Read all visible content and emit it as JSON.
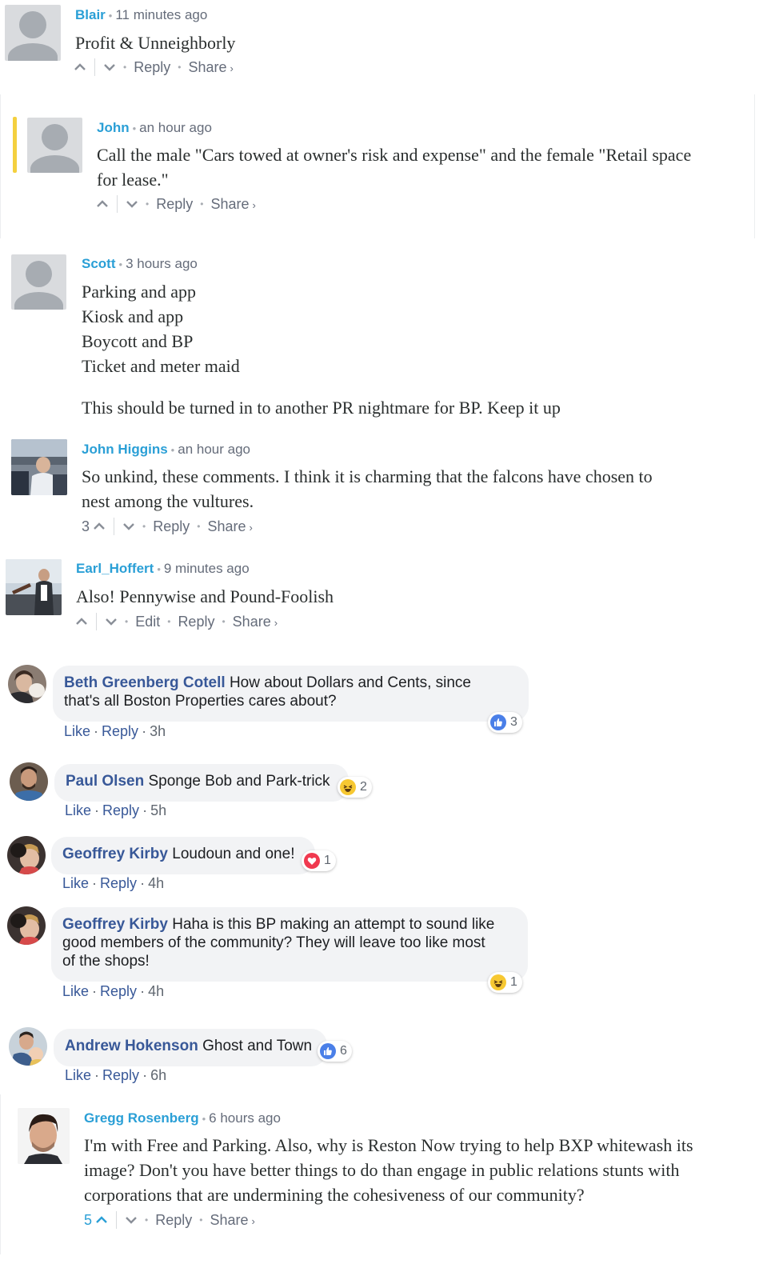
{
  "disqus": [
    {
      "name": "Blair",
      "time": "11 minutes ago",
      "lines": [
        "Profit & Unneighborly"
      ],
      "votes": "",
      "actions": [
        "Reply",
        "Share"
      ]
    },
    {
      "name": "John",
      "time": "an hour ago",
      "lines": [
        "Call the male \"Cars towed at owner's risk and expense\" and the female \"Retail space",
        "for lease.\""
      ],
      "votes": "",
      "actions": [
        "Reply",
        "Share"
      ]
    },
    {
      "name": "Scott",
      "time": "3 hours ago",
      "lines": [
        "Parking and app",
        "Kiosk and app",
        "Boycott and BP",
        "Ticket and meter maid",
        "This should be turned in to another PR nightmare for BP. Keep it up"
      ]
    },
    {
      "name": "John Higgins",
      "time": "an hour ago",
      "lines": [
        "So unkind, these comments. I think it is charming that the falcons have chosen to",
        "nest among the vultures."
      ],
      "votes": "3",
      "actions": [
        "Reply",
        "Share"
      ]
    },
    {
      "name": "Earl_Hoffert",
      "time": "9 minutes ago",
      "lines": [
        "Also! Pennywise and Pound-Foolish"
      ],
      "votes": "",
      "actions": [
        "Edit",
        "Reply",
        "Share"
      ]
    },
    {
      "name": "Gregg Rosenberg",
      "time": "6 hours ago",
      "lines": [
        "I'm with Free and Parking. Also, why is Reston Now trying to help BXP whitewash its",
        "image? Don't you have better things to do than engage in public relations stunts with",
        "corporations that are undermining the cohesiveness of our community?"
      ],
      "votes": "5",
      "actions": [
        "Reply",
        "Share"
      ]
    }
  ],
  "facebook": [
    {
      "name": "Beth Greenberg Cotell",
      "text_line1": "How about Dollars and Cents, since",
      "text_line2": "that's all Boston Properties cares about?",
      "like": "Like",
      "reply": "Reply",
      "time": "3h",
      "reaction": "like",
      "reaction_count": "3"
    },
    {
      "name": "Paul Olsen",
      "text": "Sponge Bob and Park-trick",
      "like": "Like",
      "reply": "Reply",
      "time": "5h",
      "reaction": "haha",
      "reaction_count": "2"
    },
    {
      "name": "Geoffrey Kirby",
      "text": "Loudoun and one!",
      "like": "Like",
      "reply": "Reply",
      "time": "4h",
      "reaction": "love",
      "reaction_count": "1"
    },
    {
      "name": "Geoffrey Kirby",
      "text_line1": "Haha is this BP making an attempt to sound like",
      "text_line2": "good members of the community? They will leave too like most",
      "text_line3": "of the shops!",
      "like": "Like",
      "reply": "Reply",
      "time": "4h",
      "reaction": "haha",
      "reaction_count": "1"
    },
    {
      "name": "Andrew Hokenson",
      "text": "Ghost and Town",
      "like": "Like",
      "reply": "Reply",
      "time": "6h",
      "reaction": "like",
      "reaction_count": "6"
    }
  ],
  "colors": {
    "disqus_name": "#2a9fd6",
    "fb_name": "#385898",
    "thread_highlight": "#f4d03f",
    "like_blue": "#4a7fe8",
    "love_red": "#f0394f",
    "haha_yellow": "#f7c832"
  }
}
